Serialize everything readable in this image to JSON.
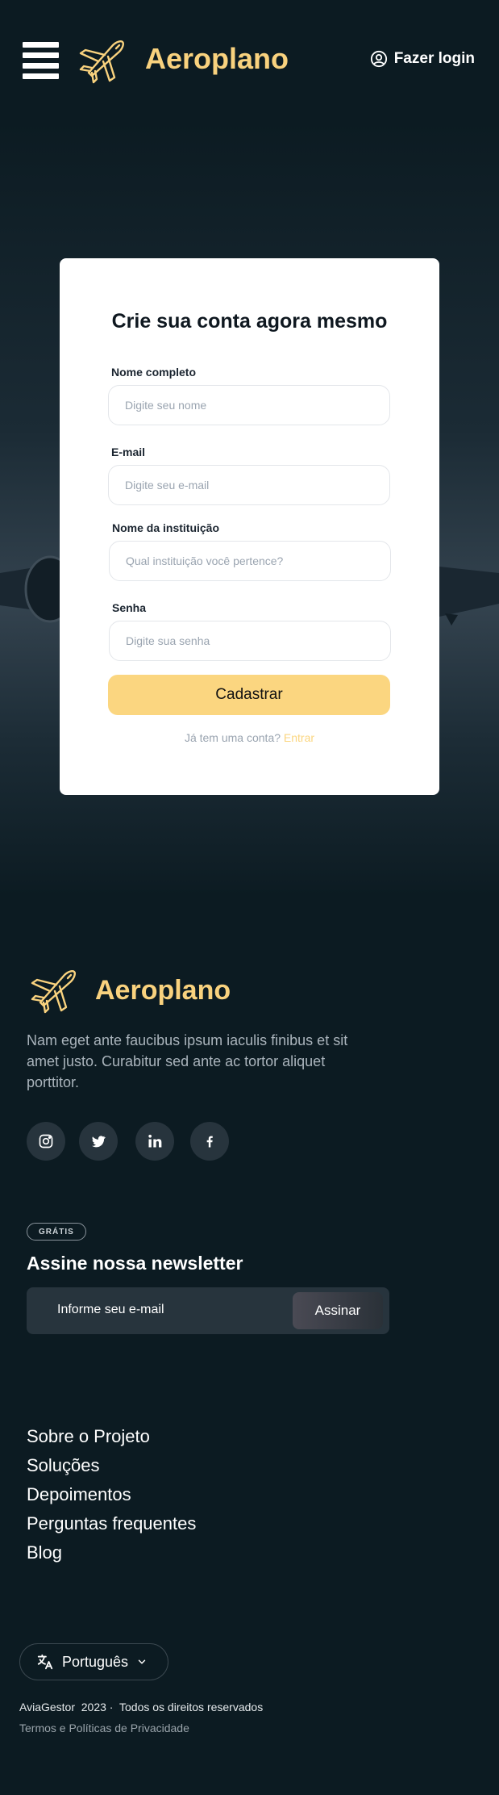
{
  "header": {
    "brand": "Aeroplano",
    "login_label": "Fazer login"
  },
  "form": {
    "title": "Crie sua conta agora mesmo",
    "fields": [
      {
        "label": "Nome completo",
        "placeholder": "Digite seu nome"
      },
      {
        "label": "E-mail",
        "placeholder": "Digite seu e-mail"
      },
      {
        "label": "Nome da instituição",
        "placeholder": "Qual instituição você pertence?"
      },
      {
        "label": "Senha",
        "placeholder": "Digite sua senha"
      }
    ],
    "submit_label": "Cadastrar",
    "have_account": "Já tem uma conta?",
    "enter_link": "Entrar"
  },
  "footer": {
    "brand": "Aeroplano",
    "description": "Nam eget ante faucibus ipsum iaculis finibus et sit amet justo. Curabitur sed ante ac tortor aliquet porttitor.",
    "social_icons": [
      "instagram-icon",
      "twitter-icon",
      "linkedin-icon",
      "facebook-icon"
    ],
    "badge": "GRÁTIS",
    "newsletter_title": "Assine nossa newsletter",
    "newsletter_placeholder": "Informe seu e-mail",
    "newsletter_button": "Assinar",
    "links": [
      "Sobre o Projeto",
      "Soluções",
      "Depoimentos",
      "Perguntas frequentes",
      "Blog"
    ],
    "language": "Português",
    "copyright": "AviaGestor  2023 ·  Todos os direitos reservados",
    "terms": "Termos e Políticas de Privacidade"
  },
  "colors": {
    "background": "#0c1b22",
    "accent": "#fbd680",
    "brand": "#f9d27e"
  }
}
